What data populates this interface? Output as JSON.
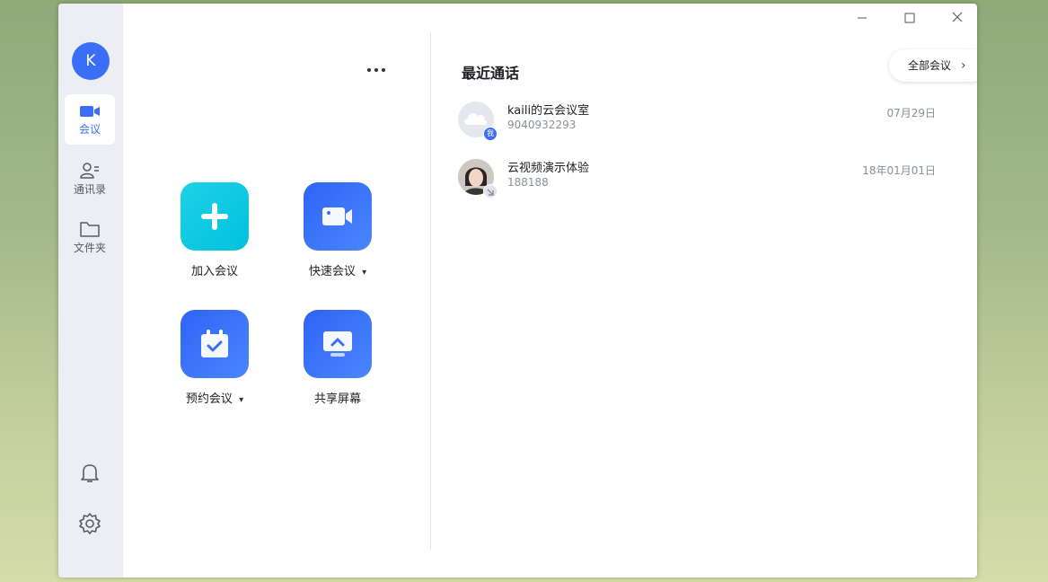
{
  "user": {
    "avatar_initial": "K",
    "avatar_color": "#3b6ef6"
  },
  "sidebar": {
    "items": [
      {
        "label": "会议",
        "icon": "video-camera-icon",
        "active": true
      },
      {
        "label": "通讯录",
        "icon": "contacts-icon",
        "active": false
      },
      {
        "label": "文件夹",
        "icon": "folder-icon",
        "active": false
      }
    ],
    "bottom_icons": [
      "bell-icon",
      "gear-icon"
    ]
  },
  "window_controls": [
    "minimize-icon",
    "maximize-icon",
    "close-icon"
  ],
  "actions": {
    "join": {
      "label": "加入会议",
      "icon": "plus-icon"
    },
    "quick": {
      "label": "快速会议",
      "icon": "video-camera-icon",
      "has_dropdown": true
    },
    "schedule": {
      "label": "预约会议",
      "icon": "calendar-check-icon",
      "has_dropdown": true
    },
    "share": {
      "label": "共享屏幕",
      "icon": "share-screen-icon"
    }
  },
  "recent": {
    "title": "最近通话",
    "all_button_label": "全部会议",
    "calls": [
      {
        "name": "kaili的云会议室",
        "id": "9040932293",
        "date": "07月29日",
        "badge": "我",
        "avatar": "cloud-avatar-icon"
      },
      {
        "name": "云视频演示体验",
        "id": "188188",
        "date": "18年01月01日",
        "avatar": "person-photo-avatar"
      }
    ]
  },
  "colors": {
    "accent": "#3b6ef6",
    "tile_cyan": "#00c2dc",
    "sidebar_bg": "#eceef3"
  }
}
